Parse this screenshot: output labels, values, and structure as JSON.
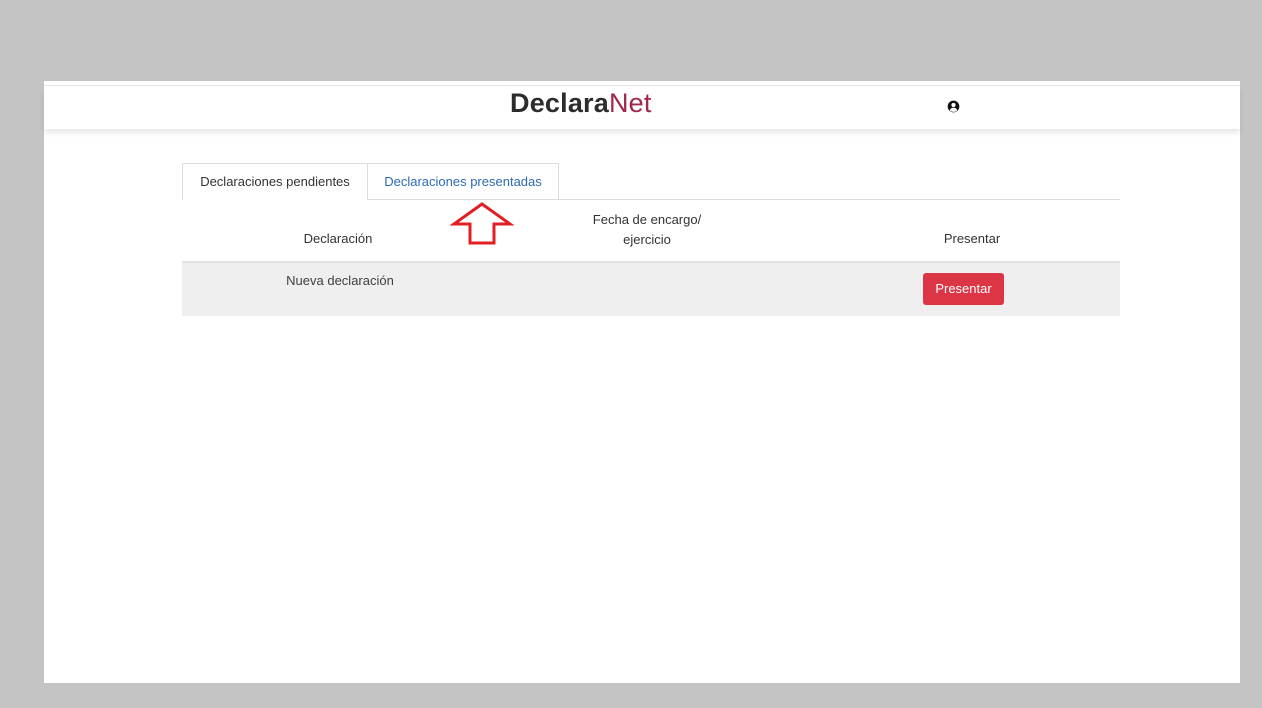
{
  "header": {
    "logo_strong": "Declara",
    "logo_light": "Net",
    "user_icon": "user-circle-icon",
    "logo_accent_color": "#a12648"
  },
  "tabs": [
    {
      "label": "Declaraciones pendientes",
      "active": true
    },
    {
      "label": "Declaraciones presentadas",
      "active": false
    }
  ],
  "table": {
    "columns": {
      "declaracion": "Declaración",
      "fecha_line1": "Fecha de encargo/",
      "fecha_line2": "ejercicio",
      "presentar": "Presentar"
    },
    "rows": [
      {
        "declaracion": "Nueva declaración",
        "fecha": "",
        "action_label": "Presentar"
      }
    ]
  },
  "annotation": {
    "icon": "up-arrow-icon",
    "color": "#e21e25"
  },
  "colors": {
    "button": "#dc3545",
    "link_tab": "#2d6bb4",
    "backdrop": "#c4c4c4"
  }
}
